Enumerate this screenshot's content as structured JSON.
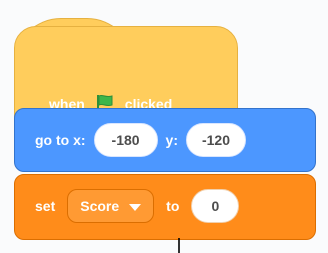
{
  "script_editor": {
    "blocks": {
      "hat": {
        "text_before": "when",
        "icon": "green-flag-icon",
        "text_after": "clicked",
        "colors": {
          "fill": "#ffcd5c",
          "stroke": "#e6b140",
          "flag": "#3eb64a"
        }
      },
      "goto": {
        "label": "go to x:",
        "x_value": "-180",
        "y_label": "y:",
        "y_value": "-120",
        "colors": {
          "fill": "#4c97ff",
          "stroke": "#3373cc"
        }
      },
      "set": {
        "label": "set",
        "variable": "Score",
        "to_label": "to",
        "value": "0",
        "colors": {
          "fill": "#ff8c1a",
          "stroke": "#db6e00"
        }
      }
    }
  }
}
